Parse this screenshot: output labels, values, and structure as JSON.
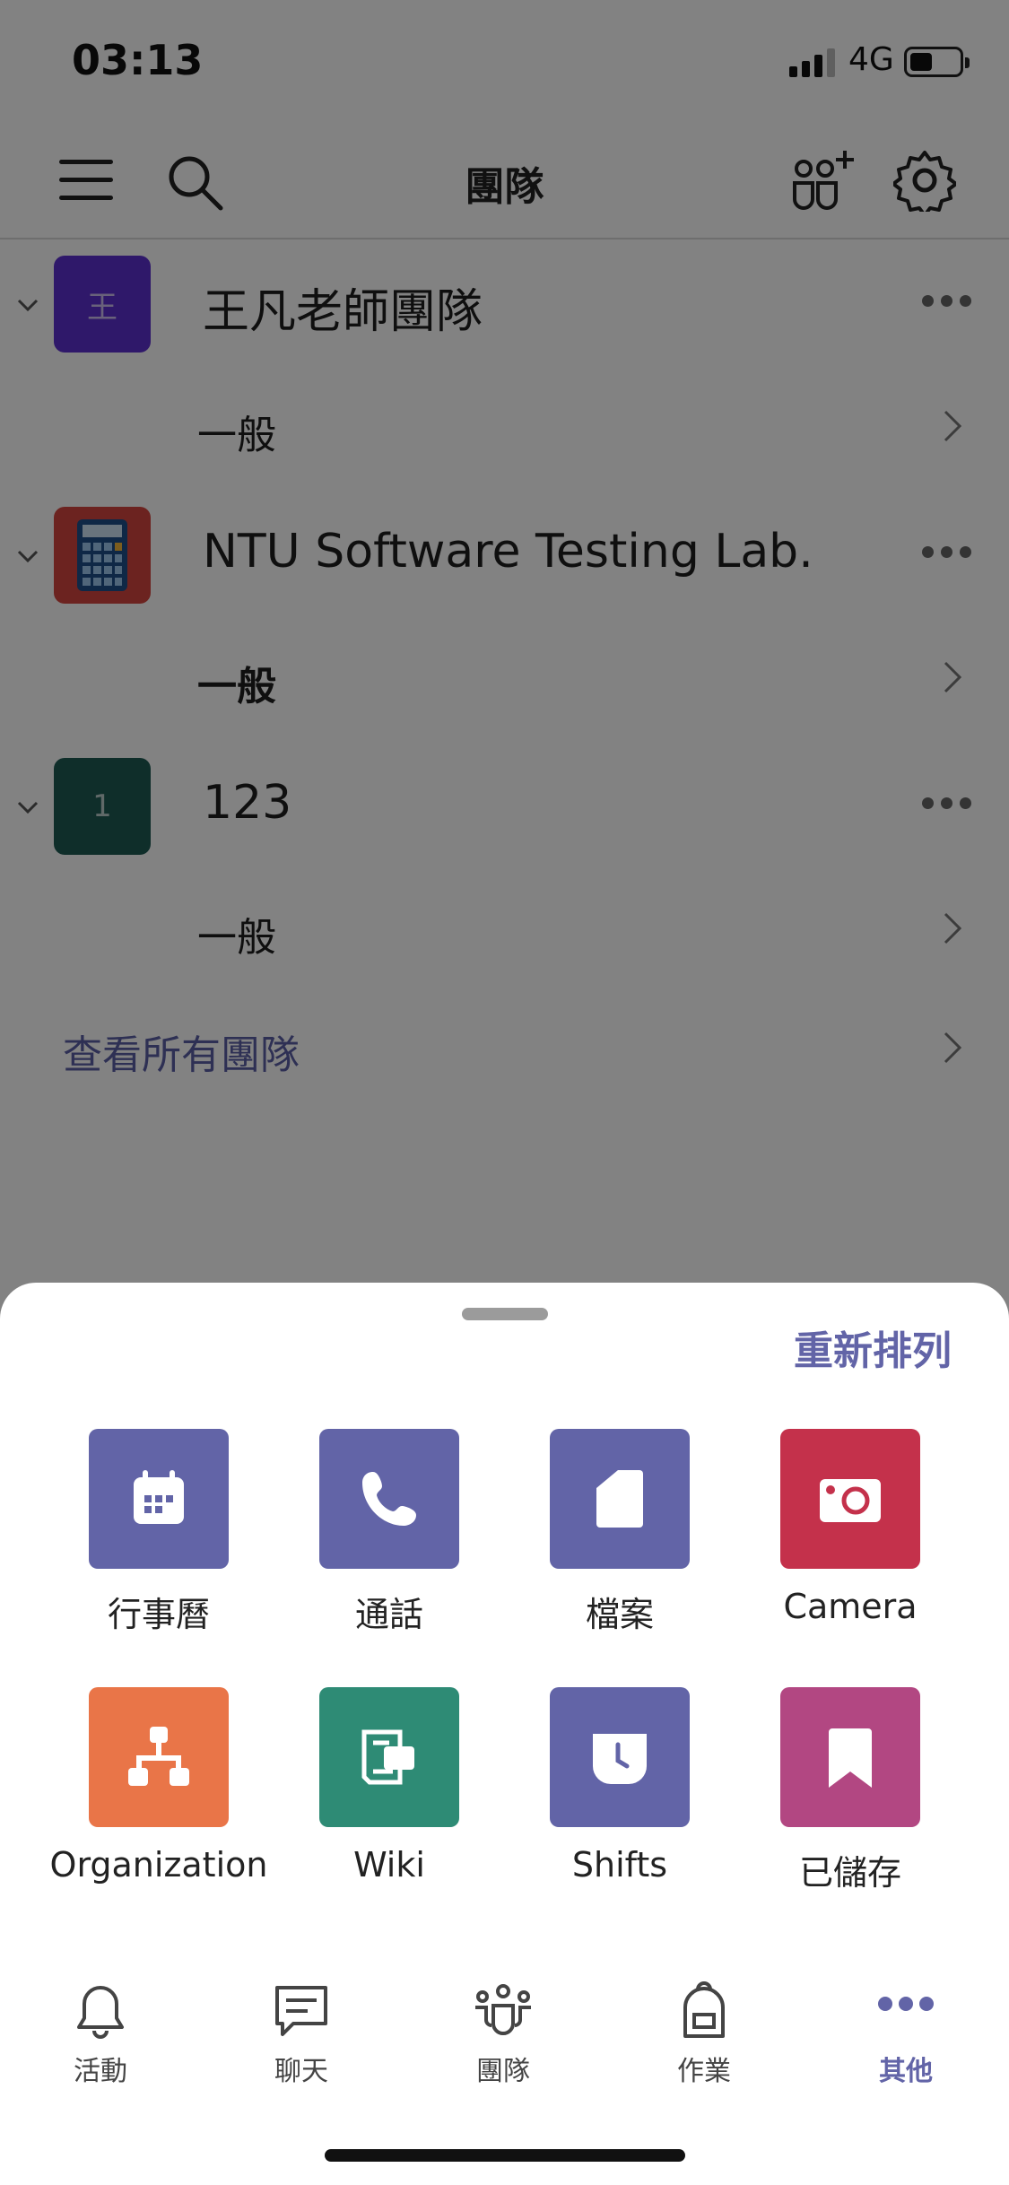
{
  "status_bar": {
    "time": "03:13",
    "network": "4G"
  },
  "header": {
    "title": "團隊"
  },
  "teams": [
    {
      "name": "王凡老師團隊",
      "avatar_text": "王",
      "avatar_color": "#5c2fd0",
      "channel": "一般",
      "channel_bold": false
    },
    {
      "name": "NTU Software Testing Lab.",
      "avatar_text": "",
      "avatar_color": "#d4463f",
      "channel": "一般",
      "channel_bold": true
    },
    {
      "name": "123",
      "avatar_text": "1",
      "avatar_color": "#1e5a54",
      "channel": "一般",
      "channel_bold": false
    }
  ],
  "see_all": "查看所有團隊",
  "sheet": {
    "reorder_label": "重新排列",
    "apps": [
      {
        "label": "行事曆",
        "icon": "calendar-icon",
        "color": "#6264a7"
      },
      {
        "label": "通話",
        "icon": "phone-icon",
        "color": "#6264a7"
      },
      {
        "label": "檔案",
        "icon": "file-icon",
        "color": "#6264a7"
      },
      {
        "label": "Camera",
        "icon": "camera-icon",
        "color": "#c4314b"
      },
      {
        "label": "Organization",
        "icon": "org-chart-icon",
        "color": "#e97548"
      },
      {
        "label": "Wiki",
        "icon": "wiki-icon",
        "color": "#2e8b75"
      },
      {
        "label": "Shifts",
        "icon": "clock-icon",
        "color": "#6264a7"
      },
      {
        "label": "已儲存",
        "icon": "bookmark-icon",
        "color": "#b24782"
      }
    ]
  },
  "tabs": [
    {
      "label": "活動",
      "icon": "bell-icon",
      "active": false
    },
    {
      "label": "聊天",
      "icon": "chat-icon",
      "active": false
    },
    {
      "label": "團隊",
      "icon": "teams-icon",
      "active": false
    },
    {
      "label": "作業",
      "icon": "backpack-icon",
      "active": false
    },
    {
      "label": "其他",
      "icon": "more-icon",
      "active": true
    }
  ]
}
